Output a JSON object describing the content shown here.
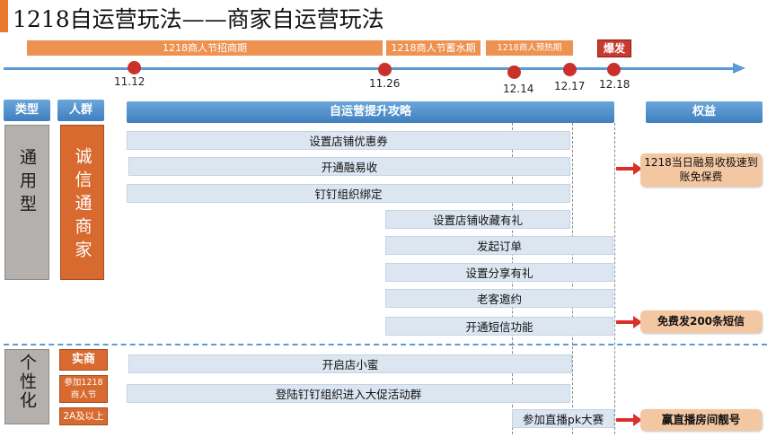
{
  "title": "1218自运营玩法——商家自运营玩法",
  "phases": [
    {
      "label": "1218商人节招商期"
    },
    {
      "label": "1218商人节蓄水期"
    },
    {
      "label": "1218商人预热期"
    },
    {
      "label": "爆发"
    }
  ],
  "timeline_dates": [
    "11.12",
    "11.26",
    "12.14",
    "12.17",
    "12.18"
  ],
  "headers": {
    "type": "类型",
    "crowd": "人群",
    "strategy": "自运营提升攻略",
    "benefits": "权益"
  },
  "general": {
    "type_label": "通用型",
    "crowd_label": "诚信通商家",
    "bars": [
      "设置店铺优惠券",
      "开通融易收",
      "钉钉组织绑定",
      "设置店铺收藏有礼",
      "发起订单",
      "设置分享有礼",
      "老客邀约",
      "开通短信功能"
    ],
    "benefits": [
      "1218当日融易收极速到账免保费",
      "免费发200条短信"
    ]
  },
  "personal": {
    "type_label": "个性化",
    "crowd_labels": [
      "实商",
      "参加1218商人节",
      "2A及以上"
    ],
    "bars": [
      "开启店小蜜",
      "登陆钉钉组织进入大促活动群",
      "参加直播pk大赛"
    ],
    "benefits": [
      "赢直播房间靓号"
    ]
  },
  "colors": {
    "timeline_blue": "#5B9BD5",
    "milestone_red": "#C9312A",
    "phase_orange": "#EE9251",
    "crowd_orange": "#D86A30",
    "type_gray": "#B3B0AE",
    "bar_blue": "#DCE6F1",
    "benefit_peach": "#F4C7A3",
    "arrow_red": "#D9302A"
  }
}
